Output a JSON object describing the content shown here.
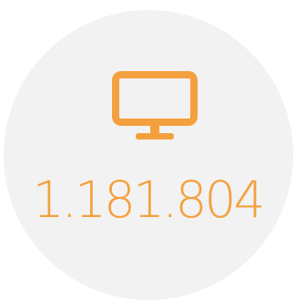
{
  "accent_color": "#f4a03f",
  "background_color": "#f2f2f2",
  "icon": "monitor-icon",
  "counter": {
    "value": "1.181.804"
  }
}
